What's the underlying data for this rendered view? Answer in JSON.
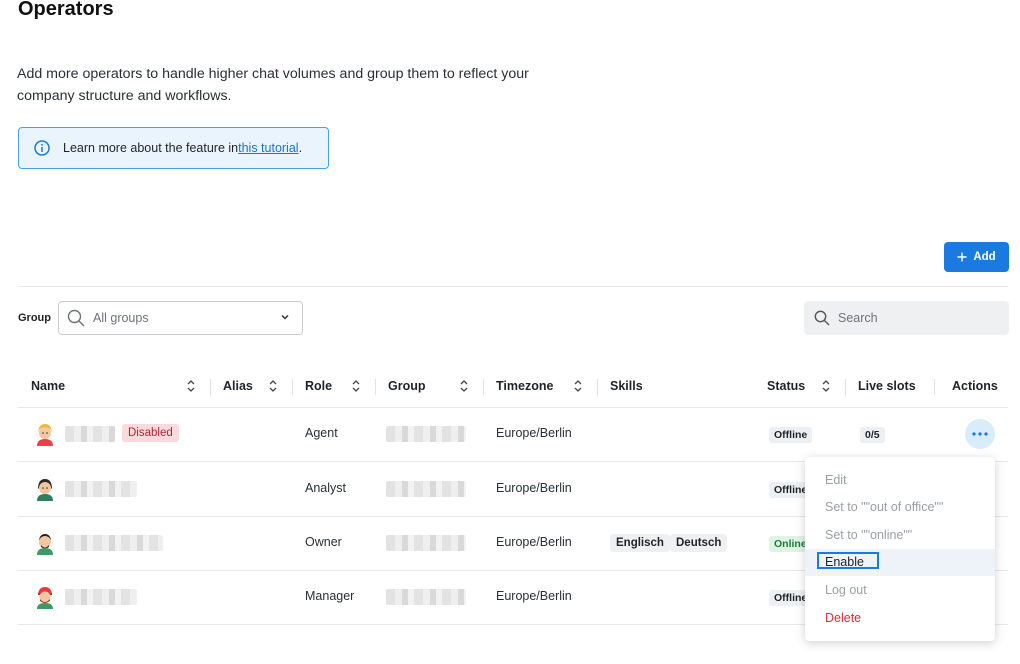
{
  "page": {
    "title": "Operators",
    "description": "Add more operators to handle higher chat volumes and group them to reflect your company structure and workflows.",
    "info_text_before": "Learn more about the feature in ",
    "info_link": "this tutorial",
    "info_text_after": "."
  },
  "toolbar": {
    "add_label": "Add",
    "group_label": "Group",
    "group_selected": "All groups",
    "search_placeholder": "Search"
  },
  "table": {
    "columns": [
      "Name",
      "Alias",
      "Role",
      "Group",
      "Timezone",
      "Skills",
      "Status",
      "Live slots",
      "Actions"
    ],
    "rows": [
      {
        "role": "Agent",
        "timezone": "Europe/Berlin",
        "status": "Offline",
        "live_slots": "0/5",
        "badge": "Disabled",
        "skills": []
      },
      {
        "role": "Analyst",
        "timezone": "Europe/Berlin",
        "status": "Offline",
        "skills": []
      },
      {
        "role": "Owner",
        "timezone": "Europe/Berlin",
        "status": "Online",
        "skills": [
          "Englisch",
          "Deutsch"
        ]
      },
      {
        "role": "Manager",
        "timezone": "Europe/Berlin",
        "status": "Offline",
        "skills": []
      }
    ]
  },
  "menu": {
    "items": [
      "Edit",
      "Set to \"\"out of office\"\"",
      "Set to \"\"online\"\"",
      "Enable",
      "Log out",
      "Delete"
    ]
  },
  "colors": {
    "accent": "#1a7ae0",
    "info_bg": "#eaf4fd",
    "danger": "#d72b3b",
    "online_bg": "#dff3e4"
  }
}
